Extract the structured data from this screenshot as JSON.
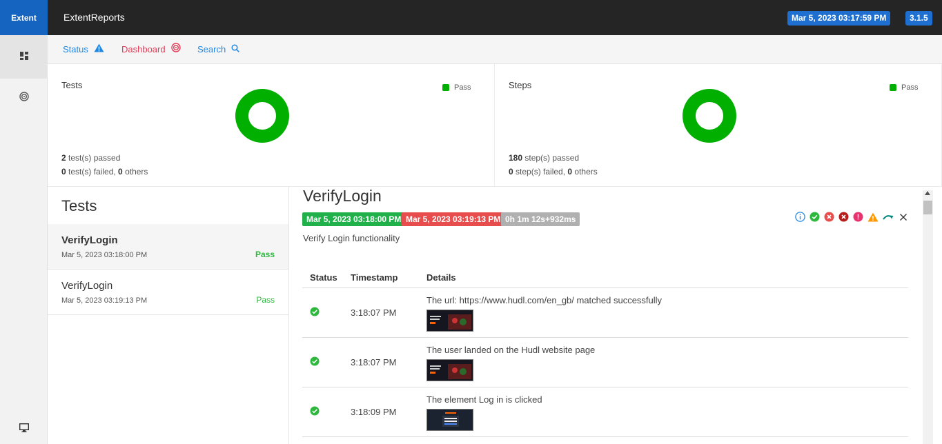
{
  "header": {
    "brand": "Extent",
    "report_name": "ExtentReports",
    "date": "Mar 5, 2023 03:17:59 PM",
    "version": "3.1.5"
  },
  "sidebar": {
    "items": [
      {
        "icon": "dashboard-grid-icon"
      },
      {
        "icon": "target-icon"
      },
      {
        "icon": "monitor-icon"
      }
    ]
  },
  "nav": {
    "status": "Status",
    "dashboard": "Dashboard",
    "search": "Search"
  },
  "summary": {
    "tests": {
      "title": "Tests",
      "legend": "Pass",
      "passed_count": "2",
      "passed_text": " test(s) passed",
      "failed_count": "0",
      "failed_text": " test(s) failed, ",
      "others_count": "0",
      "others_text": " others",
      "pass_fraction": 1.0
    },
    "steps": {
      "title": "Steps",
      "legend": "Pass",
      "passed_count": "180",
      "passed_text": " step(s) passed",
      "failed_count": "0",
      "failed_text": " step(s) failed, ",
      "others_count": "0",
      "others_text": " others",
      "pass_fraction": 1.0
    }
  },
  "tests_panel": {
    "heading": "Tests",
    "items": [
      {
        "name": "VerifyLogin",
        "time": "Mar 5, 2023 03:18:00 PM",
        "status": "Pass"
      },
      {
        "name": "VerifyLogin",
        "time": "Mar 5, 2023 03:19:13 PM",
        "status": "Pass"
      }
    ]
  },
  "detail": {
    "title": "VerifyLogin",
    "start": "Mar 5, 2023 03:18:00 PM",
    "end": "Mar 5, 2023 03:19:13 PM",
    "duration": "0h 1m 12s+932ms",
    "description": "Verify Login functionality",
    "columns": [
      "Status",
      "Timestamp",
      "Details"
    ],
    "logs": [
      {
        "time": "3:18:07 PM",
        "details": "The url: https://www.hudl.com/en_gb/ matched successfully"
      },
      {
        "time": "3:18:07 PM",
        "details": "The user landed on the Hudl website page"
      },
      {
        "time": "3:18:09 PM",
        "details": "The element Log in is clicked"
      }
    ]
  },
  "colors": {
    "pass": "#00af00",
    "accent": "#1e6fd0",
    "start_badge": "#21b14b",
    "end_badge": "#e84d4d"
  }
}
